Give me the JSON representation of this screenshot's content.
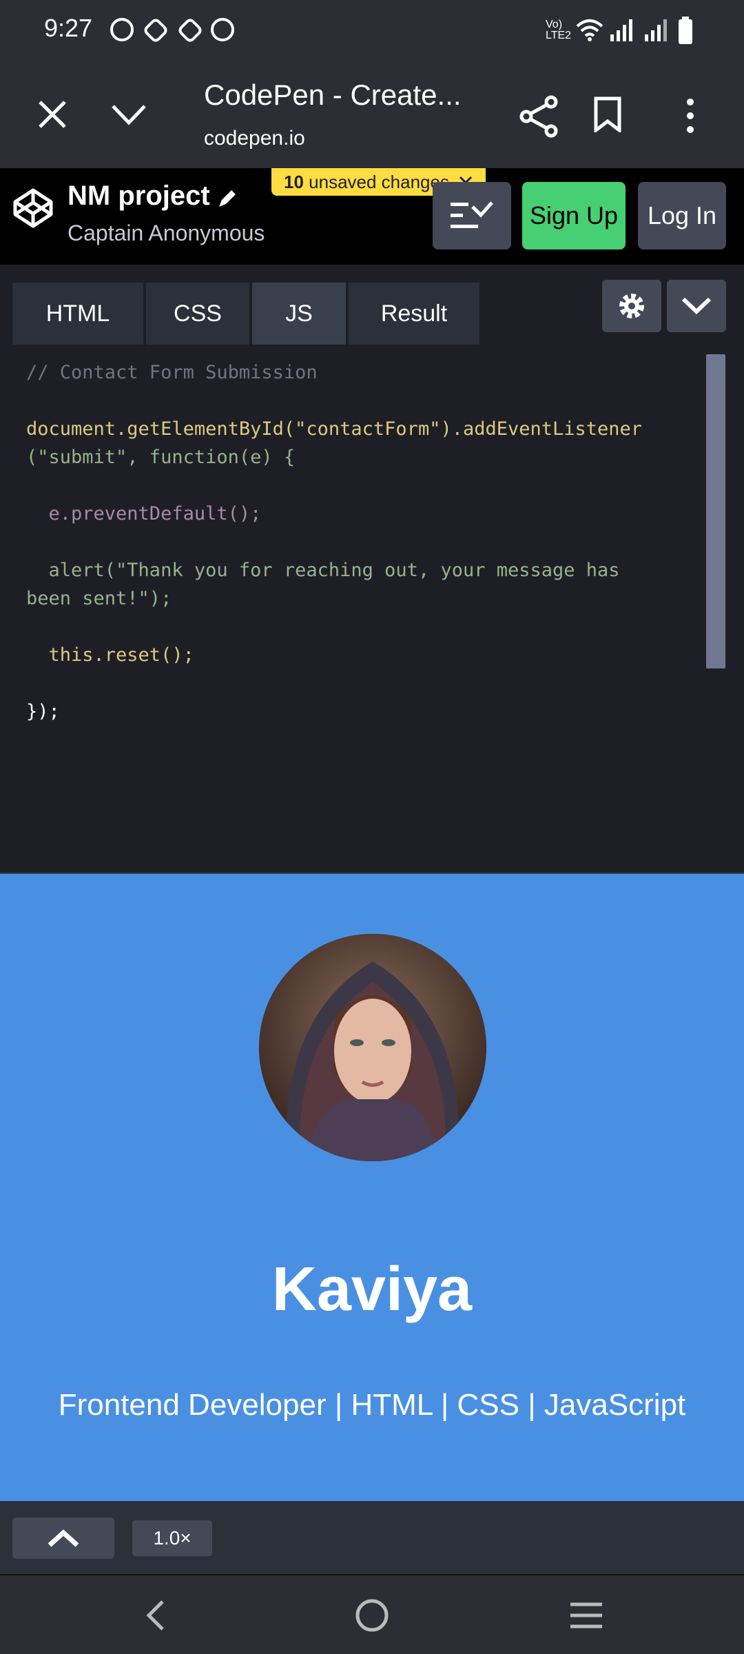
{
  "status_bar": {
    "time": "9:27",
    "network_label": "Vo) LTE2"
  },
  "browser": {
    "title": "CodePen - Create...",
    "url": "codepen.io"
  },
  "codepen": {
    "project_name": "NM project",
    "author": "Captain Anonymous",
    "unsaved_count": "10",
    "unsaved_text": "unsaved changes",
    "signup_label": "Sign Up",
    "login_label": "Log In",
    "accent_colors": {
      "signup": "#47cf73",
      "badge": "#ffdd40"
    }
  },
  "editor": {
    "tabs": [
      "HTML",
      "CSS",
      "JS",
      "Result"
    ],
    "active_tab": "JS",
    "code_lines": [
      "// Contact Form Submission",
      "",
      "document.getElementById(\"contactForm\").addEventListener",
      "(\"submit\", function(e) {",
      "",
      "  e.preventDefault();",
      "",
      "  alert(\"Thank you for reaching out, your message has",
      "been sent!\");",
      "",
      "  this.reset();",
      "",
      "});"
    ]
  },
  "preview": {
    "name": "Kaviya",
    "role": "Frontend Developer | HTML | CSS | JavaScript",
    "background": "#4a90e2"
  },
  "bottom_bar": {
    "zoom": "1.0×"
  }
}
